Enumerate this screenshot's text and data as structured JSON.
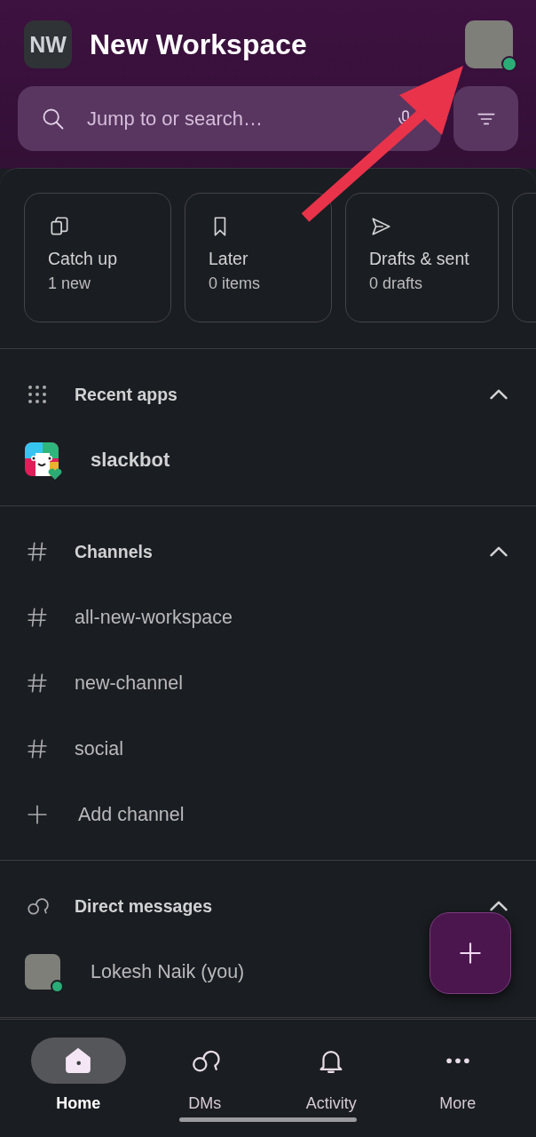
{
  "workspace": {
    "initials": "NW",
    "name": "New Workspace",
    "user_online": true
  },
  "search": {
    "placeholder": "Jump to or search…"
  },
  "quick_cards": [
    {
      "kind": "catchup",
      "title": "Catch up",
      "subtitle": "1 new"
    },
    {
      "kind": "later",
      "title": "Later",
      "subtitle": "0 items"
    },
    {
      "kind": "drafts",
      "title": "Drafts & sent",
      "subtitle": "0 drafts"
    },
    {
      "kind": "more"
    }
  ],
  "sections": [
    {
      "kind": "apps",
      "title": "Recent apps",
      "expanded": true,
      "items": [
        {
          "kind": "app",
          "label": "slackbot"
        }
      ]
    },
    {
      "kind": "channels",
      "title": "Channels",
      "expanded": true,
      "items": [
        {
          "kind": "channel",
          "label": "all-new-workspace"
        },
        {
          "kind": "channel",
          "label": "new-channel"
        },
        {
          "kind": "channel",
          "label": "social"
        },
        {
          "kind": "add",
          "label": "Add channel"
        }
      ]
    },
    {
      "kind": "dms",
      "title": "Direct messages",
      "expanded": true,
      "items": [
        {
          "kind": "person",
          "label": "Lokesh Naik (you)",
          "online": true
        }
      ]
    }
  ],
  "tabs": [
    {
      "kind": "home",
      "label": "Home",
      "selected": true
    },
    {
      "kind": "dms",
      "label": "DMs",
      "selected": false
    },
    {
      "kind": "activity",
      "label": "Activity",
      "selected": false
    },
    {
      "kind": "more",
      "label": "More",
      "selected": false
    }
  ]
}
